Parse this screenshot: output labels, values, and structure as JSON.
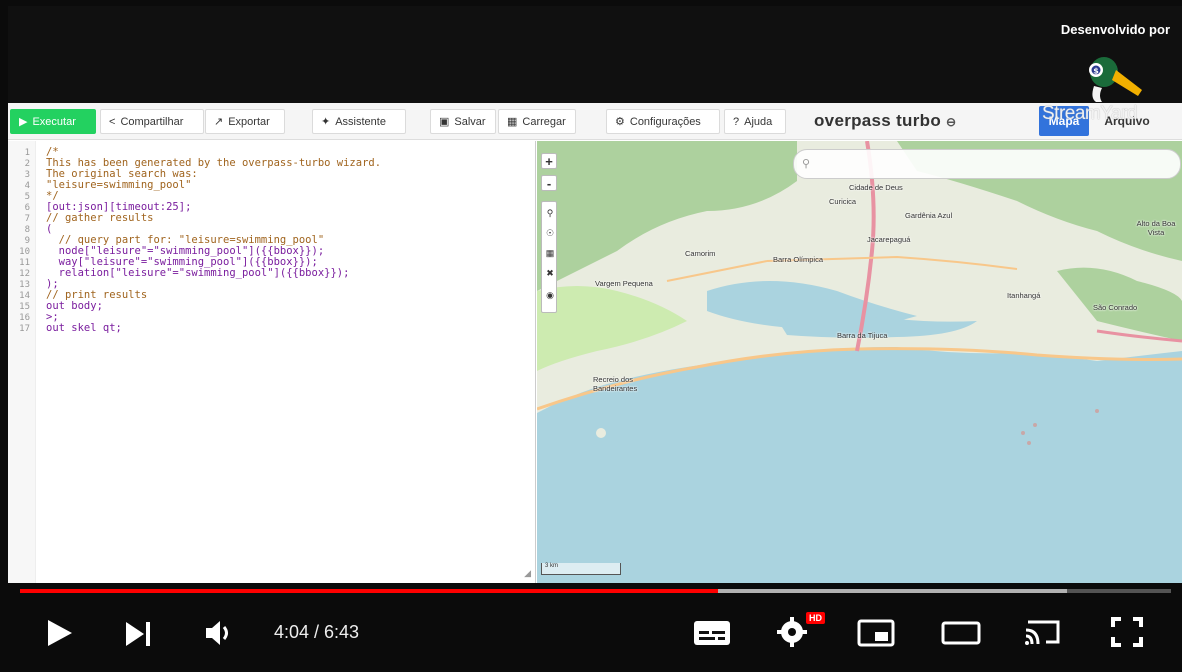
{
  "banner": {
    "brand_text": "Desenvolvido por"
  },
  "toolbar": {
    "run_label": "Executar",
    "share_label": "Compartilhar",
    "export_label": "Exportar",
    "wizard_label": "Assistente",
    "save_label": "Salvar",
    "load_label": "Carregar",
    "settings_label": "Configurações",
    "help_label": "Ajuda",
    "app_title": "overpass turbo",
    "map_tab_label": "Mapa",
    "data_tab_label": "Arquivo",
    "watermark": "StreamYard"
  },
  "editor": {
    "line_numbers": [
      "1",
      "2",
      "3",
      "4",
      "5",
      "6",
      "7",
      "8",
      "9",
      "10",
      "11",
      "12",
      "13",
      "14",
      "15",
      "16",
      "17"
    ],
    "lines": [
      "/*",
      "This has been generated by the overpass-turbo wizard.",
      "The original search was:",
      "\"leisure=swimming_pool\"",
      "*/",
      "[out:json][timeout:25];",
      "// gather results",
      "(",
      "  // query part for: \"leisure=swimming_pool\"",
      "  node[\"leisure\"=\"swimming_pool\"]({{bbox}});",
      "  way[\"leisure\"=\"swimming_pool\"]({{bbox}});",
      "  relation[\"leisure\"=\"swimming_pool\"]({{bbox}});",
      ");",
      "// print results",
      "out body;",
      ">;",
      "out skel qt;"
    ]
  },
  "map": {
    "zoom_in": "+",
    "zoom_out": "-",
    "scale_label": "3 km",
    "places": [
      "Cidade de Deus",
      "Curicica",
      "Gardênia Azul",
      "Alto da Boa Vista",
      "Camorim",
      "Jacarepaguá",
      "Barra Olímpica",
      "Vargem Pequena",
      "Itanhangá",
      "São Conrado",
      "Barra da Tijuca",
      "Recreio dos Bandeirantes"
    ]
  },
  "player": {
    "time_display": "4:04 / 6:43",
    "hd_badge": "HD",
    "progress_played": 0.606,
    "progress_buffered": 0.91
  }
}
